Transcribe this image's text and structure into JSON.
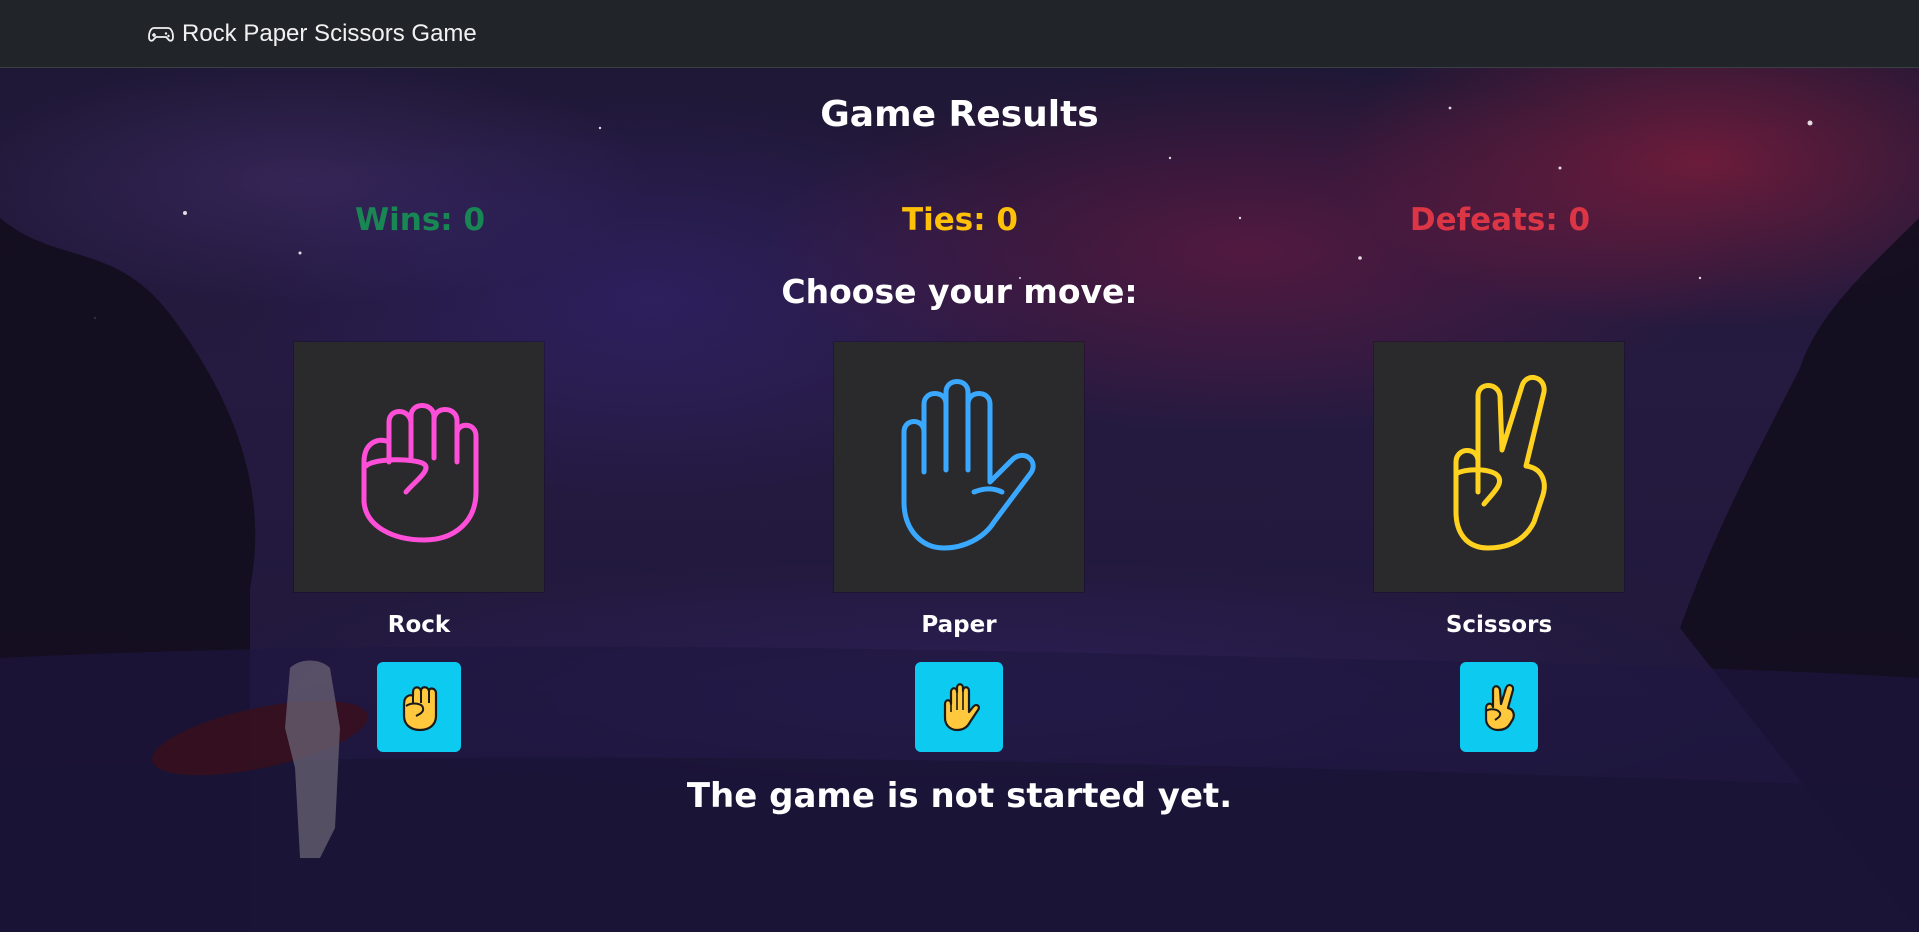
{
  "navbar": {
    "brand": "Rock Paper Scissors Game",
    "icon": "gamepad-icon"
  },
  "header": {
    "title": "Game Results"
  },
  "score": {
    "wins_label": "Wins: 0",
    "ties_label": "Ties: 0",
    "defeats_label": "Defeats: 0",
    "colors": {
      "wins": "#198754",
      "ties": "#ffc107",
      "defeats": "#dc3545"
    }
  },
  "prompt": "Choose your move:",
  "moves": [
    {
      "name": "Rock",
      "image": "neon-fist-icon",
      "button_icon": "raised-fist-emoji",
      "neon_color": "#ff4fd8"
    },
    {
      "name": "Paper",
      "image": "neon-hand-icon",
      "button_icon": "raised-hand-emoji",
      "neon_color": "#3aa8ff"
    },
    {
      "name": "Scissors",
      "image": "neon-victory-hand-icon",
      "button_icon": "victory-hand-emoji",
      "neon_color": "#ffd21f"
    }
  ],
  "button_color": "#0dcaf0",
  "status": "The game is not started yet."
}
